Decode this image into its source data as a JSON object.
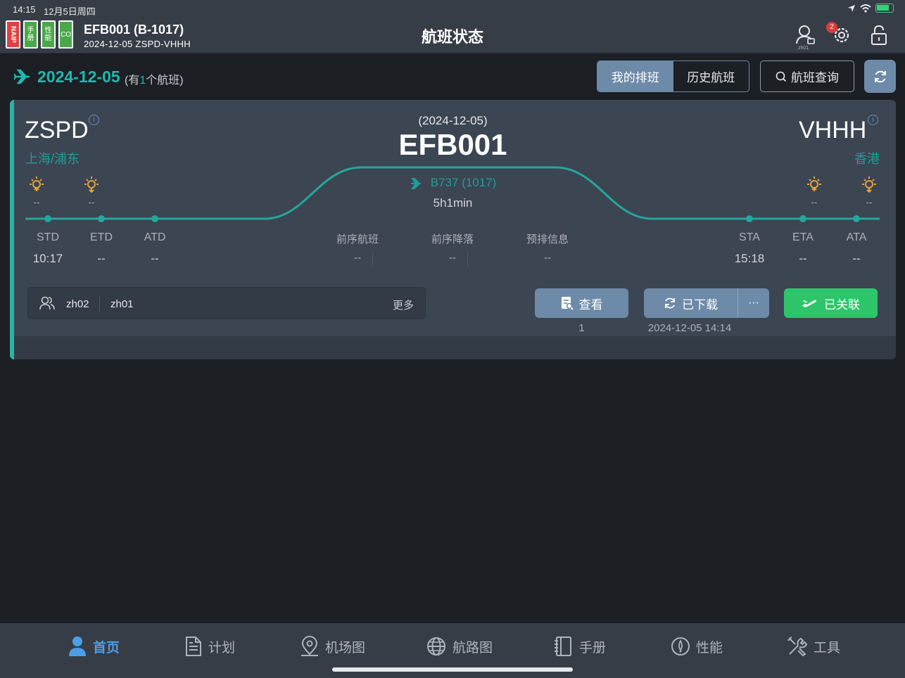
{
  "status_bar": {
    "time": "14:15",
    "date": "12月5日周四"
  },
  "header": {
    "app_icons": [
      {
        "label": "NAIP",
        "color": "#e04040"
      },
      {
        "label": "手册",
        "color": "#4aa84a"
      },
      {
        "label": "性能",
        "color": "#4aa84a"
      },
      {
        "label": "CO",
        "color": "#4aa84a"
      }
    ],
    "flight_id": "EFB001 (B-1017)",
    "flight_sub": "2024-12-05 ZSPD-VHHH",
    "title": "航班状态",
    "user_label": "zh01",
    "notification_count": "2",
    "icons": [
      "user-icon",
      "settings-gear-icon",
      "lock-icon"
    ]
  },
  "toolbar": {
    "date": "2024-12-05",
    "count_prefix": "(有",
    "count": "1",
    "count_suffix": "个航班)",
    "tabs": [
      {
        "label": "我的排班",
        "active": true
      },
      {
        "label": "历史航班",
        "active": false
      }
    ],
    "search_label": "航班查询",
    "accent": "#21b8ae"
  },
  "flight": {
    "date": "(2024-12-05)",
    "number": "EFB001",
    "aircraft": "B737 (1017)",
    "duration": "5h1min",
    "origin": {
      "code": "ZSPD",
      "city": "上海/浦东"
    },
    "destination": {
      "code": "VHHH",
      "city": "香港"
    },
    "weather": [
      "--",
      "--",
      "--",
      "--"
    ],
    "departure_times": [
      {
        "label": "STD",
        "value": "10:17"
      },
      {
        "label": "ETD",
        "value": "--"
      },
      {
        "label": "ATD",
        "value": "--"
      }
    ],
    "middle_info": [
      {
        "label": "前序航班",
        "value": "--"
      },
      {
        "label": "前序降落",
        "value": "--"
      },
      {
        "label": "预排信息",
        "value": "--"
      }
    ],
    "arrival_times": [
      {
        "label": "STA",
        "value": "15:18"
      },
      {
        "label": "ETA",
        "value": "--"
      },
      {
        "label": "ATA",
        "value": "--"
      }
    ],
    "crew": [
      "zh02",
      "zh01"
    ],
    "more_label": "更多",
    "actions": {
      "view_label": "查看",
      "view_count": "1",
      "download_label": "已下载",
      "download_more": "···",
      "download_time": "2024-12-05 14:14",
      "linked_label": "已关联"
    }
  },
  "tabbar": [
    {
      "label": "首页",
      "icon": "home-user-icon",
      "active": true
    },
    {
      "label": "计划",
      "icon": "document-icon",
      "active": false
    },
    {
      "label": "机场图",
      "icon": "map-pin-icon",
      "active": false
    },
    {
      "label": "航路图",
      "icon": "globe-icon",
      "active": false
    },
    {
      "label": "手册",
      "icon": "manual-book-icon",
      "active": false
    },
    {
      "label": "性能",
      "icon": "gauge-icon",
      "active": false
    },
    {
      "label": "工具",
      "icon": "tools-icon",
      "active": false
    }
  ]
}
